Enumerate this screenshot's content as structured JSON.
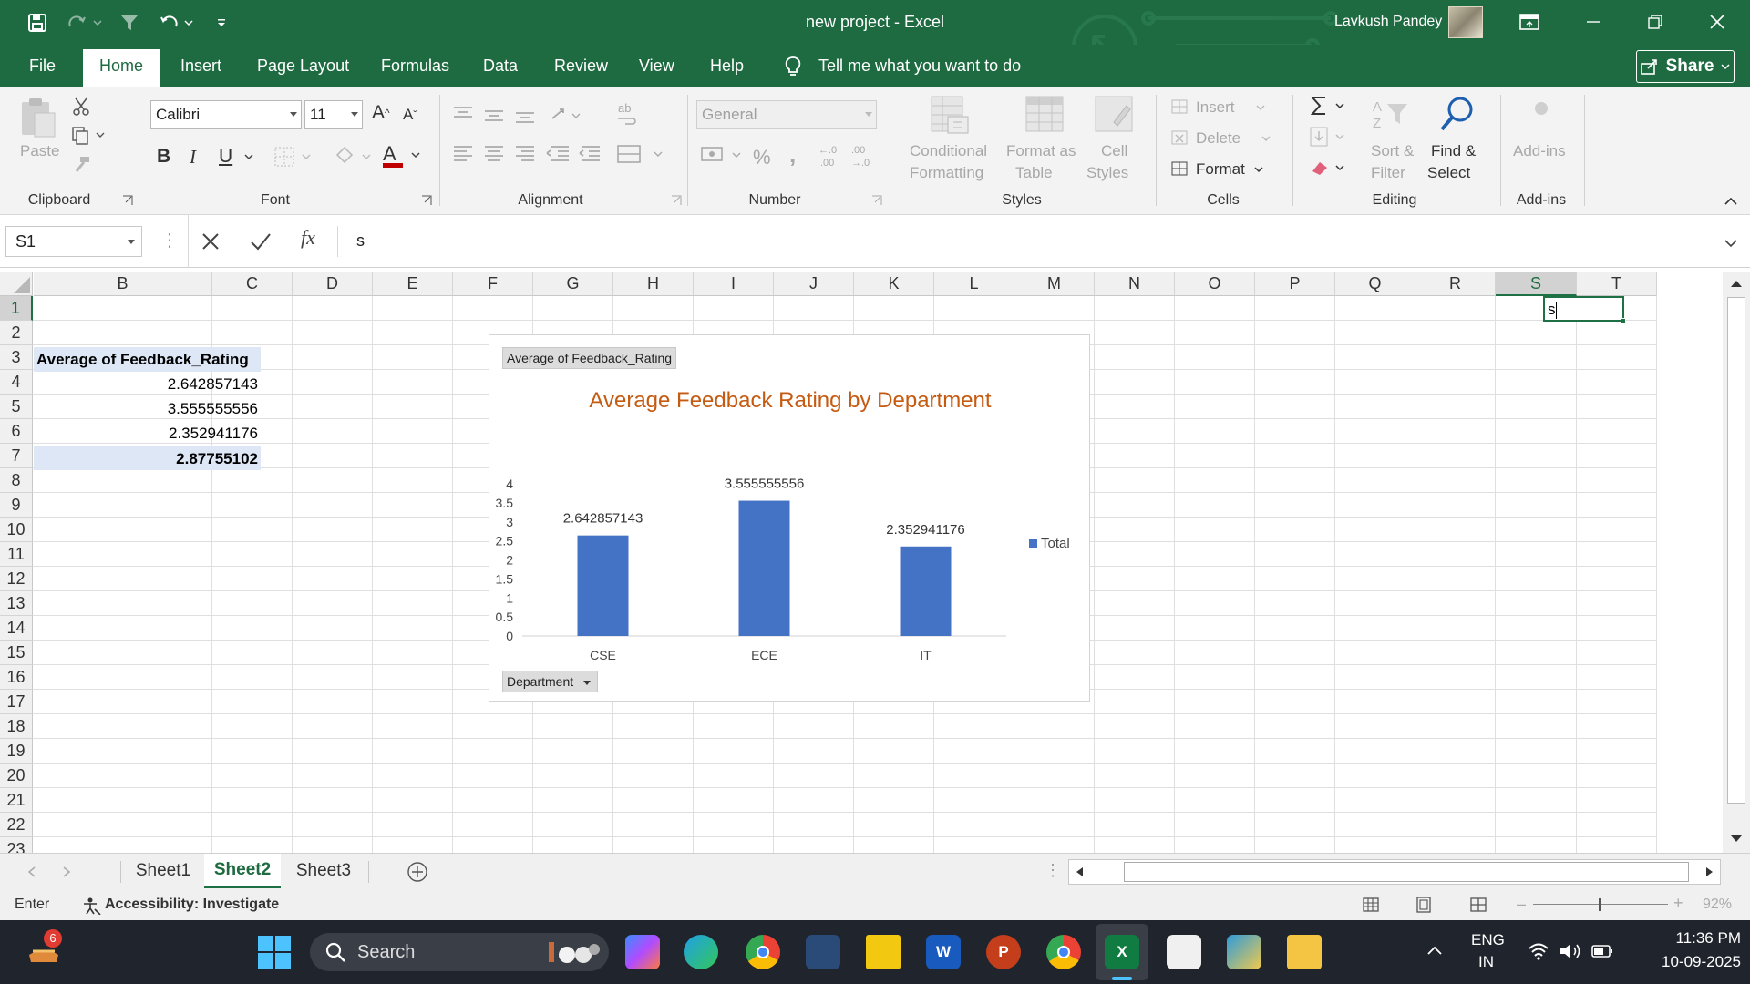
{
  "window": {
    "title": "new project  -  Excel",
    "user": "Lavkush Pandey"
  },
  "menu": {
    "tabs": [
      "File",
      "Home",
      "Insert",
      "Page Layout",
      "Formulas",
      "Data",
      "Review",
      "View",
      "Help"
    ],
    "tell_me": "Tell me what you want to do",
    "share": "Share"
  },
  "ribbon": {
    "clipboard": {
      "paste": "Paste",
      "label": "Clipboard"
    },
    "font": {
      "name": "Calibri",
      "size": "11",
      "label": "Font",
      "bold": "B",
      "italic": "I",
      "underline": "U"
    },
    "alignment": {
      "label": "Alignment"
    },
    "number": {
      "format": "General",
      "label": "Number",
      "percent": "%",
      "comma": ","
    },
    "styles": {
      "conditional_1": "Conditional",
      "conditional_2": "Formatting",
      "table_1": "Format as",
      "table_2": "Table",
      "cell_1": "Cell",
      "cell_2": "Styles",
      "label": "Styles"
    },
    "cells": {
      "insert": "Insert",
      "delete": "Delete",
      "format": "Format",
      "label": "Cells"
    },
    "editing": {
      "sort_1": "Sort &",
      "sort_2": "Filter",
      "find_1": "Find &",
      "find_2": "Select",
      "label": "Editing"
    },
    "addins": {
      "button": "Add-ins",
      "label": "Add-ins"
    }
  },
  "formula_bar": {
    "name_box": "S1",
    "fx": "fx",
    "value": "s"
  },
  "grid": {
    "columns": [
      "B",
      "C",
      "D",
      "E",
      "F",
      "G",
      "H",
      "I",
      "J",
      "K",
      "L",
      "M",
      "N",
      "O",
      "P",
      "Q",
      "R",
      "S",
      "T"
    ],
    "rows": [
      "1",
      "2",
      "3",
      "4",
      "5",
      "6",
      "7",
      "8",
      "9",
      "10",
      "11",
      "12",
      "13",
      "14",
      "15",
      "16",
      "17",
      "18",
      "19",
      "20",
      "21",
      "22",
      "23"
    ],
    "selected_column": "S",
    "selected_row": "1",
    "cells": {
      "b3": "Average of Feedback_Rating",
      "b4": "2.642857143",
      "b5": "3.555555556",
      "b6": "2.352941176",
      "b7": "2.87755102",
      "s1": "s"
    }
  },
  "chart_data": {
    "type": "bar",
    "title": "Average Feedback Rating by Department",
    "value_field": "Average of Feedback_Rating",
    "axis_field": "Department",
    "categories": [
      "CSE",
      "ECE",
      "IT"
    ],
    "series": [
      {
        "name": "Total",
        "values": [
          2.642857143,
          3.555555556,
          2.352941176
        ],
        "color": "#4472c4"
      }
    ],
    "data_labels": [
      "2.642857143",
      "3.555555556",
      "2.352941176"
    ],
    "y_ticks": [
      "0",
      "0.5",
      "1",
      "1.5",
      "2",
      "2.5",
      "3",
      "3.5",
      "4"
    ],
    "ylim": [
      0,
      4
    ],
    "grid": false,
    "legend": "right"
  },
  "sheets": {
    "tabs": [
      "Sheet1",
      "Sheet2",
      "Sheet3"
    ],
    "active": "Sheet2"
  },
  "status": {
    "mode": "Enter",
    "accessibility": "Accessibility: Investigate",
    "zoom": "92%"
  },
  "taskbar": {
    "search": "Search",
    "badge": "6",
    "lang_1": "ENG",
    "lang_2": "IN",
    "time": "11:36 PM",
    "date": "10-09-2025"
  },
  "colors": {
    "excel_green": "#1e6b41",
    "accent": "#1e7145",
    "bar": "#4472c4",
    "chart_title": "#c55a11"
  }
}
